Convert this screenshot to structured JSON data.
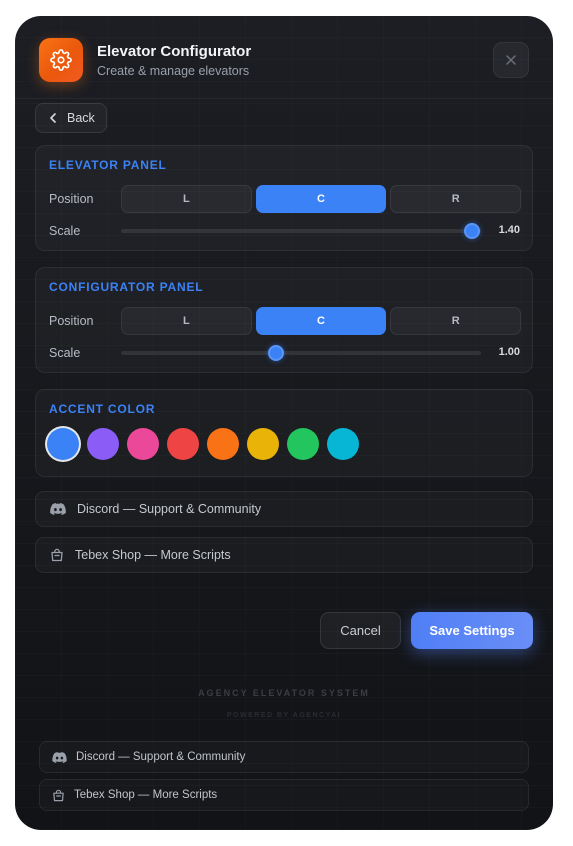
{
  "header": {
    "title": "Elevator Configurator",
    "subtitle": "Create & manage elevators",
    "app_icon": "gear-icon",
    "close_icon": "close-icon"
  },
  "nav": {
    "back_label": "Back",
    "back_icon": "chevron-left-icon"
  },
  "elevator_panel": {
    "title": "ELEVATOR PANEL",
    "position_label": "Position",
    "positions": [
      "L",
      "C",
      "R"
    ],
    "selected_position": "C",
    "scale_label": "Scale",
    "scale_value": "1.40",
    "scale_fraction": 0.975
  },
  "configurator_panel": {
    "title": "CONFIGURATOR PANEL",
    "position_label": "Position",
    "positions": [
      "L",
      "C",
      "R"
    ],
    "selected_position": "C",
    "scale_label": "Scale",
    "scale_value": "1.00",
    "scale_fraction": 0.43
  },
  "accent": {
    "title": "ACCENT COLOR",
    "colors": [
      "#3b82f6",
      "#8b5cf6",
      "#ec4899",
      "#ef4444",
      "#f97316",
      "#eab308",
      "#22c55e",
      "#06b6d4"
    ],
    "selected": "#3b82f6"
  },
  "links": {
    "discord": "Discord — Support & Community",
    "tebex": "Tebex Shop — More Scripts"
  },
  "actions": {
    "cancel": "Cancel",
    "save": "Save Settings"
  },
  "footer": {
    "title": "AGENCY ELEVATOR SYSTEM",
    "subtitle": "POWERED BY AGENCYAI"
  },
  "external_links": {
    "discord": "Discord — Support & Community",
    "tebex": "Tebex Shop — More Scripts"
  }
}
